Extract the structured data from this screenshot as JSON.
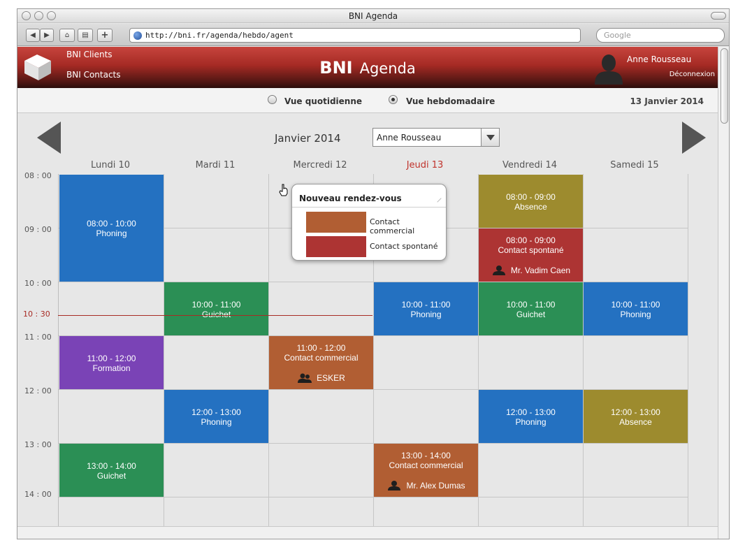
{
  "browser": {
    "title": "BNI Agenda",
    "url": "http://bni.fr/agenda/hebdo/agent",
    "search_placeholder": "Google",
    "nav": {
      "back": "◀",
      "forward": "▶",
      "home": "⌂",
      "print": "▤",
      "add": "+"
    }
  },
  "header": {
    "links": [
      "BNI Clients",
      "BNI Contacts"
    ],
    "brand_bold": "BNI",
    "brand_rest": "Agenda",
    "user_name": "Anne Rousseau",
    "logout": "Déconnexion"
  },
  "view": {
    "daily_label": "Vue quotidienne",
    "weekly_label": "Vue hebdomadaire",
    "selected": "weekly",
    "current_date": "13 Janvier 2014"
  },
  "calendar": {
    "month": "Janvier 2014",
    "selected_user": "Anne Rousseau",
    "days": [
      {
        "label": "Lundi 10",
        "today": false
      },
      {
        "label": "Mardi 11",
        "today": false
      },
      {
        "label": "Mercredi 12",
        "today": false
      },
      {
        "label": "Jeudi 13",
        "today": true
      },
      {
        "label": "Vendredi 14",
        "today": false
      },
      {
        "label": "Samedi 15",
        "today": false
      }
    ],
    "time_labels": [
      "08 : 00",
      "09 : 00",
      "10 : 00",
      "11 : 00",
      "12 : 00",
      "13 : 00",
      "14 : 00"
    ],
    "now_label": "10 : 30",
    "events": [
      {
        "day": 0,
        "start": 8,
        "end": 10,
        "time": "08:00 - 10:00",
        "title": "Phoning",
        "color": "#2471c1",
        "person": null
      },
      {
        "day": 0,
        "start": 11,
        "end": 12,
        "time": "11:00 - 12:00",
        "title": "Formation",
        "color": "#7a43b6",
        "person": null
      },
      {
        "day": 0,
        "start": 13,
        "end": 14,
        "time": "13:00 - 14:00",
        "title": "Guichet",
        "color": "#2b8f55",
        "person": null
      },
      {
        "day": 1,
        "start": 10,
        "end": 11,
        "time": "10:00 - 11:00",
        "title": "Guichet",
        "color": "#2b8f55",
        "person": null
      },
      {
        "day": 1,
        "start": 12,
        "end": 13,
        "time": "12:00 - 13:00",
        "title": "Phoning",
        "color": "#2471c1",
        "person": null
      },
      {
        "day": 2,
        "start": 11,
        "end": 12,
        "time": "11:00 - 12:00",
        "title": "Contact commercial",
        "color": "#b15e33",
        "person": "ESKER"
      },
      {
        "day": 3,
        "start": 10,
        "end": 11,
        "time": "10:00 - 11:00",
        "title": "Phoning",
        "color": "#2471c1",
        "person": null
      },
      {
        "day": 3,
        "start": 13,
        "end": 14,
        "time": "13:00 - 14:00",
        "title": "Contact commercial",
        "color": "#b15e33",
        "person": "Mr. Alex Dumas"
      },
      {
        "day": 4,
        "start": 8,
        "end": 9,
        "time": "08:00 - 09:00",
        "title": "Absence",
        "color": "#9d8b2e",
        "person": null
      },
      {
        "day": 4,
        "start": 9,
        "end": 10,
        "time": "08:00 - 09:00",
        "title": "Contact spontané",
        "color": "#ad3433",
        "person": "Mr. Vadim Caen"
      },
      {
        "day": 4,
        "start": 10,
        "end": 11,
        "time": "10:00 - 11:00",
        "title": "Guichet",
        "color": "#2b8f55",
        "person": null
      },
      {
        "day": 4,
        "start": 12,
        "end": 13,
        "time": "12:00 - 13:00",
        "title": "Phoning",
        "color": "#2471c1",
        "person": null
      },
      {
        "day": 5,
        "start": 10,
        "end": 11,
        "time": "10:00 - 11:00",
        "title": "Phoning",
        "color": "#2471c1",
        "person": null
      },
      {
        "day": 5,
        "start": 12,
        "end": 13,
        "time": "12:00 - 13:00",
        "title": "Absence",
        "color": "#9d8b2e",
        "person": null
      }
    ]
  },
  "popup": {
    "title": "Nouveau rendez-vous",
    "options": [
      {
        "label": "Contact commercial",
        "color": "#b15e33"
      },
      {
        "label": "Contact spontané",
        "color": "#ad3433"
      }
    ]
  },
  "colors": {
    "header": "#a52a24",
    "today": "#c0322b",
    "now_line": "#a82b24"
  },
  "icons": [
    "cube-logo-icon",
    "user-silhouette-icon",
    "prev-arrow-icon",
    "next-arrow-icon",
    "hand-cursor-icon",
    "person-icon",
    "group-icon"
  ]
}
